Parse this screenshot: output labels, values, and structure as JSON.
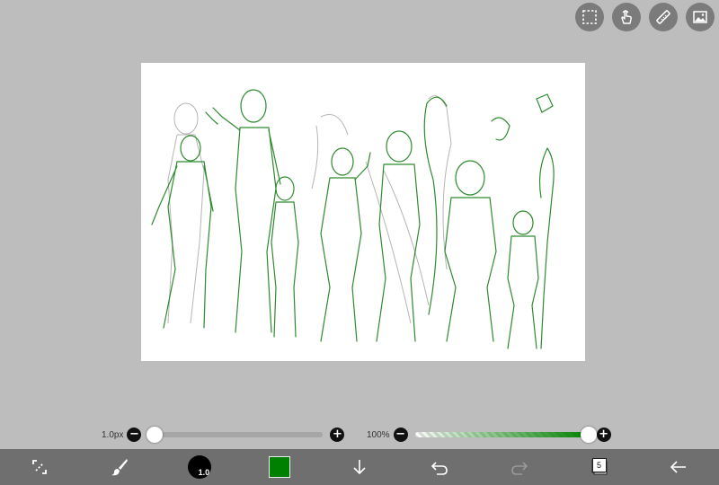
{
  "top_tools": [
    {
      "name": "selection-icon"
    },
    {
      "name": "hand-gesture-icon"
    },
    {
      "name": "ruler-icon"
    },
    {
      "name": "image-icon"
    }
  ],
  "brush_size": {
    "label": "1.0px",
    "minus": "−",
    "plus": "+",
    "value_fraction": 0.02
  },
  "brush_opacity": {
    "label": "100%",
    "minus": "−",
    "plus": "+",
    "value_fraction": 1.0
  },
  "toolbar": {
    "brush_size_preview": "1.0",
    "layers_count": "5",
    "current_color": "#008000"
  },
  "colors": {
    "background": "#bdbdbd",
    "canvas": "#ffffff",
    "toolbar": "#6f6f6f",
    "stroke_green": "#2e8b2e",
    "stroke_gray": "#b5b5b5"
  }
}
